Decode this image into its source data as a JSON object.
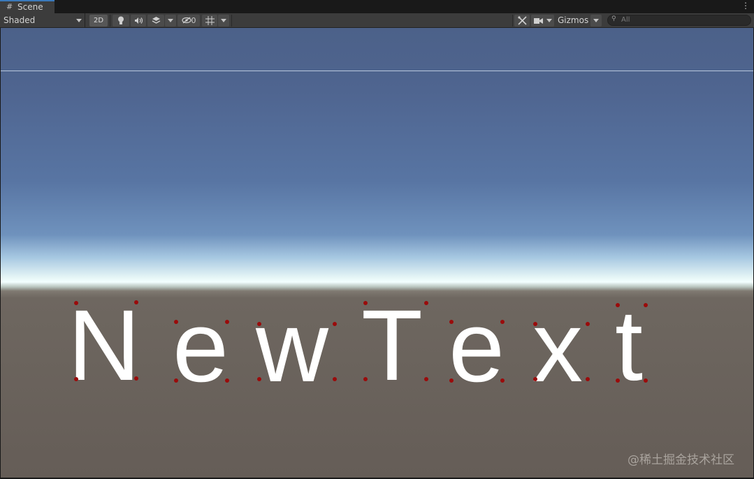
{
  "tab": {
    "label": "Scene",
    "icon": "grid-icon"
  },
  "toolbar": {
    "draw_mode": "Shaded",
    "mode_2d": "2D",
    "hidden_count": "0",
    "gizmos": "Gizmos",
    "search_placeholder": "All",
    "icons": {
      "lighting": "lightbulb-icon",
      "audio": "speaker-icon",
      "effects": "layers-icon",
      "visibility": "eye-slash-icon",
      "grid": "grid-snap-icon",
      "tools": "tools-icon",
      "camera": "camera-icon",
      "search": "search-icon",
      "more": "kebab-menu-icon"
    }
  },
  "scene": {
    "text": [
      "N",
      "e",
      "w",
      "T",
      "e",
      "x",
      "t"
    ],
    "vertex_color": "#9a0b0b",
    "text_color": "#ffffff"
  },
  "watermark": "@稀土掘金技术社区"
}
